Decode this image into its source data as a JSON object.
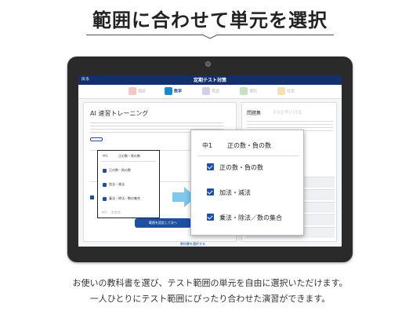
{
  "headline": "範囲に合わせて単元を選択",
  "screen": {
    "back_label": "戻る",
    "title": "定期テスト対策",
    "tabs": [
      {
        "label": "国語",
        "color": "#f4a3a0"
      },
      {
        "label": "数学",
        "color": "#1e88c7"
      },
      {
        "label": "英語",
        "color": "#b0a8d8"
      },
      {
        "label": "理科",
        "color": "#9ccf9a"
      },
      {
        "label": "社会",
        "color": "#f1cf8a"
      }
    ],
    "active_tab": "数学",
    "left_panel_title": "AI 速習トレーニング",
    "right_panel_title": "問題集",
    "right_panel_subtitle": "EXERCISE",
    "mini_selector": {
      "grade": "中1",
      "unit_title": "正の数・負の数",
      "items": [
        "正の数・負の数",
        "加法・減法",
        "乗法・除法／数の集合"
      ],
      "next_grade": "中1",
      "next_unit": "文字式"
    },
    "cta_label": "範囲を設定して次へ",
    "footer_link": "教科書を選択する"
  },
  "popup": {
    "grade": "中1",
    "unit_title": "正の数・負の数",
    "items": [
      "正の数・負の数",
      "加法・減法",
      "乗法・除法／数の集合"
    ]
  },
  "caption": {
    "line1": "お使いの教科書を選び、テスト範囲の単元を自由に選択いただけます。",
    "line2": "一人ひとりにテスト範囲にぴったり合わせた演習ができます。"
  }
}
